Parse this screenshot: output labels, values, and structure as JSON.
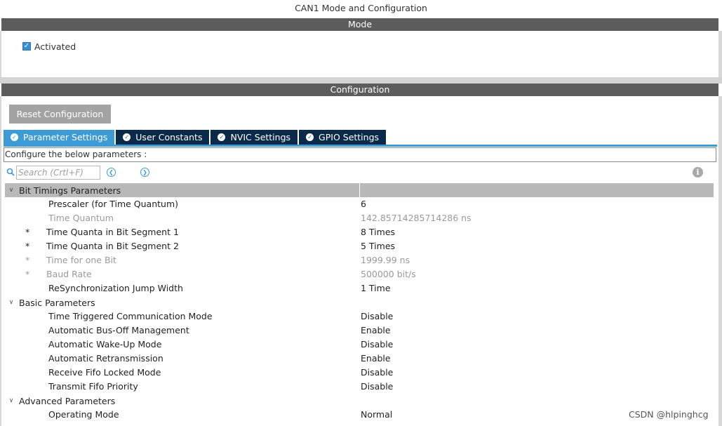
{
  "window": {
    "title": "CAN1 Mode and Configuration"
  },
  "mode": {
    "header": "Mode",
    "activated": {
      "label": "Activated",
      "checked": true
    }
  },
  "configuration": {
    "header": "Configuration",
    "reset_label": "Reset Configuration",
    "tabs": [
      {
        "label": "Parameter Settings",
        "active": true,
        "icon": "check-circle-icon"
      },
      {
        "label": "User Constants",
        "active": false,
        "icon": "check-circle-icon"
      },
      {
        "label": "NVIC Settings",
        "active": false,
        "icon": "check-circle-icon"
      },
      {
        "label": "GPIO Settings",
        "active": false,
        "icon": "check-circle-icon"
      }
    ],
    "description": "Configure the below parameters :",
    "search": {
      "placeholder": "Search (Crtl+F)",
      "value": ""
    },
    "groups": [
      {
        "label": "Bit Timings Parameters",
        "params": [
          {
            "star": "",
            "name": "Prescaler (for Time Quantum)",
            "value": "6",
            "enabled": true
          },
          {
            "star": "",
            "name": "Time Quantum",
            "value": "142.85714285714286 ns",
            "enabled": false
          },
          {
            "star": "*",
            "name": "Time Quanta in Bit Segment 1",
            "value": "8 Times",
            "enabled": true
          },
          {
            "star": "*",
            "name": "Time Quanta in Bit Segment 2",
            "value": "5 Times",
            "enabled": true
          },
          {
            "star": "*",
            "name": "Time for one Bit",
            "value": "1999.99 ns",
            "enabled": false
          },
          {
            "star": "*",
            "name": "Baud Rate",
            "value": "500000 bit/s",
            "enabled": false
          },
          {
            "star": "",
            "name": "ReSynchronization Jump Width",
            "value": "1 Time",
            "enabled": true
          }
        ]
      },
      {
        "label": "Basic Parameters",
        "params": [
          {
            "star": "",
            "name": "Time Triggered Communication Mode",
            "value": "Disable",
            "enabled": true
          },
          {
            "star": "",
            "name": "Automatic Bus-Off Management",
            "value": "Enable",
            "enabled": true
          },
          {
            "star": "",
            "name": "Automatic Wake-Up Mode",
            "value": "Disable",
            "enabled": true
          },
          {
            "star": "",
            "name": "Automatic Retransmission",
            "value": "Enable",
            "enabled": true
          },
          {
            "star": "",
            "name": "Receive Fifo Locked Mode",
            "value": "Disable",
            "enabled": true
          },
          {
            "star": "",
            "name": "Transmit Fifo Priority",
            "value": "Disable",
            "enabled": true
          }
        ]
      },
      {
        "label": "Advanced Parameters",
        "params": [
          {
            "star": "",
            "name": "Operating Mode",
            "value": "Normal",
            "enabled": true
          }
        ]
      }
    ]
  },
  "watermark": "CSDN @hlpinghcg"
}
